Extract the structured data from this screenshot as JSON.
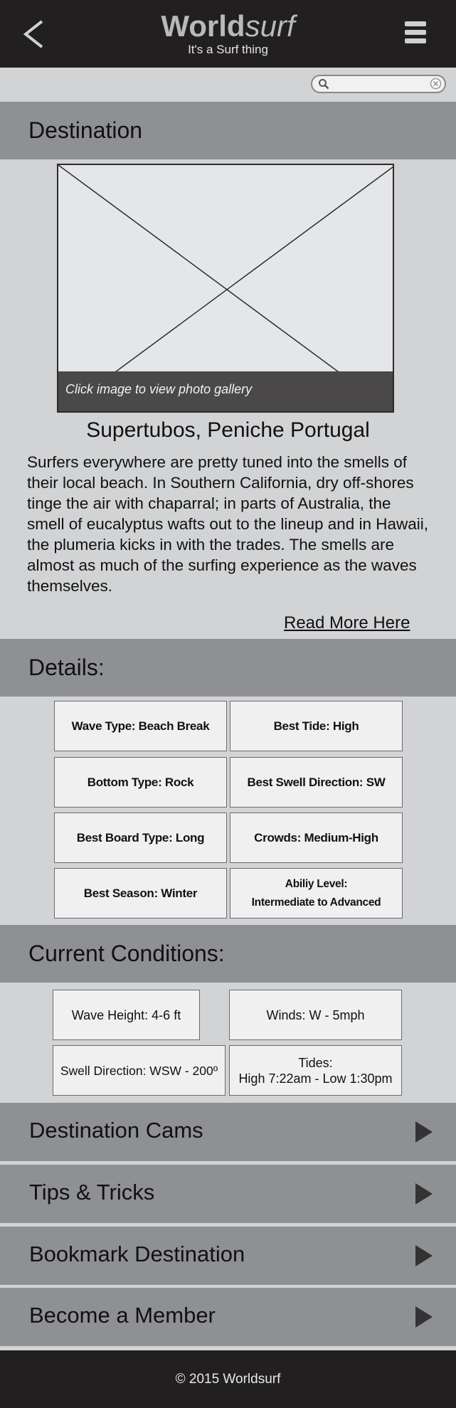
{
  "header": {
    "brand_bold": "World",
    "brand_light": "surf",
    "tagline": "It's a Surf thing",
    "back_icon": "chevron-left-icon",
    "menu_icon": "hamburger-menu-icon"
  },
  "search": {
    "placeholder": "",
    "value": ""
  },
  "destination": {
    "section_title": "Destination",
    "photo_caption": "Click image to view photo gallery",
    "name": "Supertubos, Peniche Portugal",
    "description": "Surfers everywhere are pretty tuned into the smells of their local beach. In Southern California, dry off-shores tinge the air with chaparral; in parts of Australia, the smell of eucalyptus wafts out to the lineup and in Hawaii, the plumeria kicks in with the trades. The smells are almost as much of the surfing experience as the waves themselves.",
    "read_more": "Read More Here"
  },
  "details": {
    "section_title": "Details:",
    "items": [
      "Wave Type: Beach Break",
      "Best Tide: High",
      "Bottom Type: Rock",
      "Best Swell Direction: SW",
      "Best Board Type: Long",
      "Crowds: Medium-High",
      "Best Season: Winter",
      "Abiliy Level:",
      "Intermediate to Advanced"
    ]
  },
  "conditions": {
    "section_title": "Current Conditions:",
    "wave_height": "Wave Height: 4-6 ft",
    "winds": "Winds: W - 5mph",
    "swell_direction": "Swell Direction: WSW - 200º",
    "tides_label": "Tides:",
    "tides_value": "High 7:22am - Low 1:30pm"
  },
  "nav": {
    "items": [
      "Destination Cams",
      "Tips & Tricks",
      "Bookmark Destination",
      "Become a Member"
    ]
  },
  "footer": {
    "copyright": "© 2015 Worldsurf"
  },
  "colors": {
    "header_bg": "#221f20",
    "page_bg": "#d2d3d5",
    "band_bg": "#8f9094",
    "cell_bg": "#f0f0f0"
  }
}
